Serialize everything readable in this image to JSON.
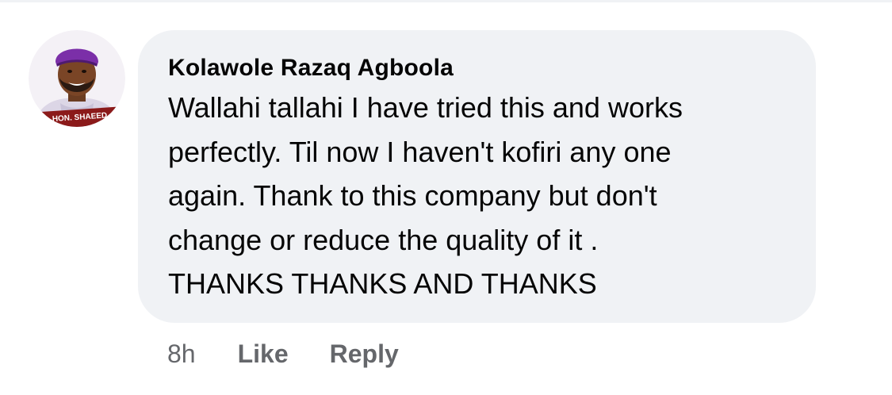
{
  "comment": {
    "author": "Kolawole Razaq Agboola",
    "avatar_caption": "HON. SHAEED",
    "text_lines": [
      "Wallahi tallahi I have tried this and works",
      "perfectly. Til now I haven't kofiri any one",
      "again. Thank to this company but don't",
      "change or reduce the quality of it .",
      "THANKS THANKS AND THANKS"
    ],
    "timestamp": "8h",
    "like_label": "Like",
    "reply_label": "Reply"
  },
  "colors": {
    "bubble_bg": "#f0f2f5",
    "meta_text": "#65676b",
    "body_text": "#050505",
    "cap_purple": "#7b2fa8"
  }
}
